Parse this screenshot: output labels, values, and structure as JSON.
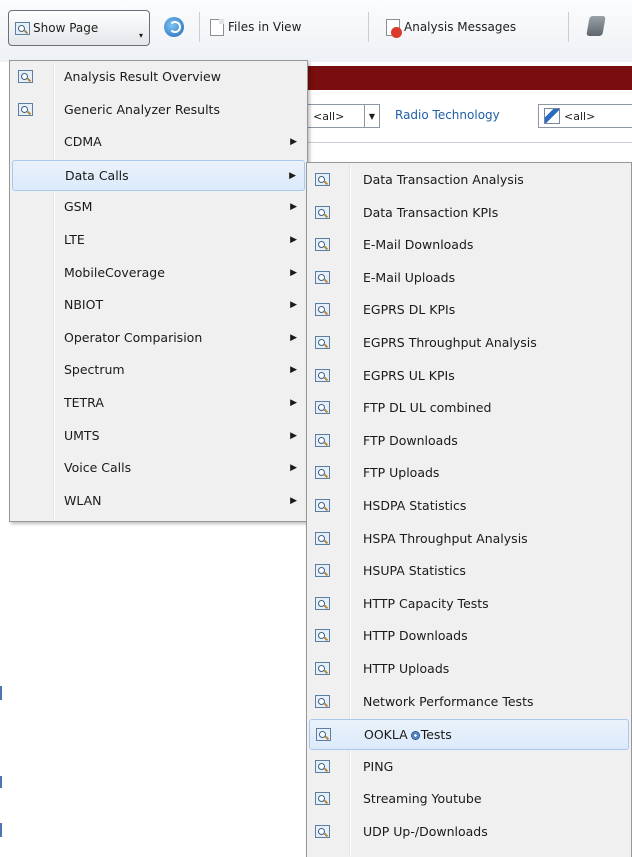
{
  "toolbar": {
    "show_page_label": "Show Page",
    "files_in_view_label": "Files in View",
    "analysis_messages_label": "Analysis Messages"
  },
  "filters": {
    "combo1_value": "<all>",
    "radio_technology_label": "Radio Technology",
    "combo2_value": "<all>"
  },
  "menu": {
    "items": [
      {
        "label": "Analysis Result Overview",
        "icon": "magnifier-icon",
        "submenu": false
      },
      {
        "label": "Generic Analyzer Results",
        "icon": "magnifier-icon",
        "submenu": false
      },
      {
        "label": "CDMA",
        "icon": null,
        "submenu": true
      },
      {
        "label": "Data Calls",
        "icon": null,
        "submenu": true,
        "highlighted": true
      },
      {
        "label": "GSM",
        "icon": null,
        "submenu": true
      },
      {
        "label": "LTE",
        "icon": null,
        "submenu": true
      },
      {
        "label": "MobileCoverage",
        "icon": null,
        "submenu": true
      },
      {
        "label": "NBIOT",
        "icon": null,
        "submenu": true
      },
      {
        "label": "Operator Comparision",
        "icon": null,
        "submenu": true
      },
      {
        "label": "Spectrum",
        "icon": null,
        "submenu": true
      },
      {
        "label": "TETRA",
        "icon": null,
        "submenu": true
      },
      {
        "label": "UMTS",
        "icon": null,
        "submenu": true
      },
      {
        "label": "Voice Calls",
        "icon": null,
        "submenu": true
      },
      {
        "label": "WLAN",
        "icon": null,
        "submenu": true
      }
    ]
  },
  "submenu": {
    "items": [
      {
        "label": "Data Transaction Analysis"
      },
      {
        "label": "Data Transaction KPIs"
      },
      {
        "label": "E-Mail Downloads"
      },
      {
        "label": "E-Mail Uploads"
      },
      {
        "label": "EGPRS DL KPIs"
      },
      {
        "label": "EGPRS Throughput Analysis"
      },
      {
        "label": "EGPRS UL KPIs"
      },
      {
        "label": "FTP DL UL combined"
      },
      {
        "label": "FTP Downloads"
      },
      {
        "label": "FTP Uploads"
      },
      {
        "label": "HSDPA Statistics"
      },
      {
        "label": "HSPA Throughput Analysis"
      },
      {
        "label": "HSUPA Statistics"
      },
      {
        "label": "HTTP Capacity Tests"
      },
      {
        "label": "HTTP Downloads"
      },
      {
        "label": "HTTP Uploads"
      },
      {
        "label": "Network Performance Tests"
      },
      {
        "label": "OOKLA",
        "label_suffix": "Tests",
        "highlighted": true
      },
      {
        "label": "PING"
      },
      {
        "label": "Streaming Youtube"
      },
      {
        "label": "UDP Up-/Downloads"
      }
    ]
  },
  "colors": {
    "header_strip": "#7a0d0d",
    "highlight_border": "#a8c8ee",
    "link_blue": "#1f5fa8"
  }
}
